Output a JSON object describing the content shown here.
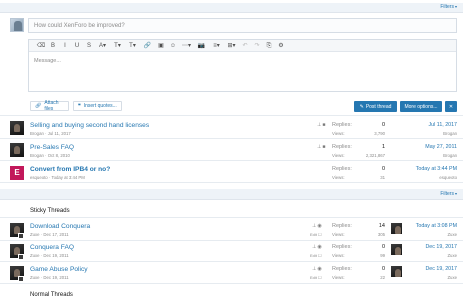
{
  "top_filters": {
    "label": "Filters",
    "caret": "▾"
  },
  "quick_thread": {
    "title_placeholder": "How could XenForo be improved?",
    "message_placeholder": "Message...",
    "toolbar": [
      "⌫",
      "B",
      "I",
      "U",
      "S",
      "A▾",
      "T▾",
      "T▾",
      "🔗",
      "▣",
      "☺",
      "⋯▾",
      "📷",
      "≡▾",
      "⊞▾",
      "↶",
      "↷",
      "⎘",
      "⚙"
    ],
    "attach_label": "Attach files",
    "insert_quotes_label": "Insert quotes...",
    "post_thread_label": "Post thread",
    "more_options_label": "More options...",
    "close_label": "✕"
  },
  "pinned_threads": [
    {
      "title": "Selling and buying second hand licenses",
      "author": "Brogan",
      "date": "Jul 11, 2017",
      "replies_label": "Replies:",
      "replies": "0",
      "views_label": "Views:",
      "views": "3,790",
      "last_date": "Jul 11, 2017",
      "last_user": "Brogan",
      "avatar": "person"
    },
    {
      "title": "Pre-Sales FAQ",
      "author": "Brogan",
      "date": "Oct 8, 2010",
      "replies_label": "Replies:",
      "replies": "1",
      "views_label": "Views:",
      "views": "2,321,867",
      "last_date": "May 27, 2011",
      "last_user": "Brogan",
      "avatar": "person"
    },
    {
      "title": "Convert from IPB4 or no?",
      "author": "esqueoto",
      "date": "Today at 3:44 PM",
      "replies_label": "Replies:",
      "replies": "0",
      "views_label": "Views:",
      "views": "31",
      "last_date": "Today at 3:44 PM",
      "last_user": "esqueoto",
      "avatar": "E"
    }
  ],
  "mid_filters": {
    "label": "Filters",
    "caret": "▾"
  },
  "sticky_section": "Sticky Threads",
  "sticky_threads": [
    {
      "title": "Download Conquera",
      "author": "Zuxe",
      "date": "Dec 17, 2011",
      "edit": "Edit",
      "replies_label": "Replies:",
      "replies": "14",
      "views_label": "Views:",
      "views": "305",
      "last_date": "Today at 3:08 PM",
      "last_user": "Zuxe"
    },
    {
      "title": "Conquera FAQ",
      "author": "Zuxe",
      "date": "Dec 19, 2011",
      "edit": "Edit",
      "replies_label": "Replies:",
      "replies": "0",
      "views_label": "Views:",
      "views": "99",
      "last_date": "Dec 19, 2017",
      "last_user": "Zuxe"
    },
    {
      "title": "Game Abuse Policy",
      "author": "Zuxe",
      "date": "Dec 19, 2011",
      "edit": "Edit",
      "replies_label": "Replies:",
      "replies": "0",
      "views_label": "Views:",
      "views": "22",
      "last_date": "Dec 19, 2017",
      "last_user": "Zuxe"
    }
  ],
  "normal_section": "Normal Threads",
  "colors": {
    "link": "#2577b1",
    "accent": "#2577b1",
    "bar": "#eef3f8"
  }
}
